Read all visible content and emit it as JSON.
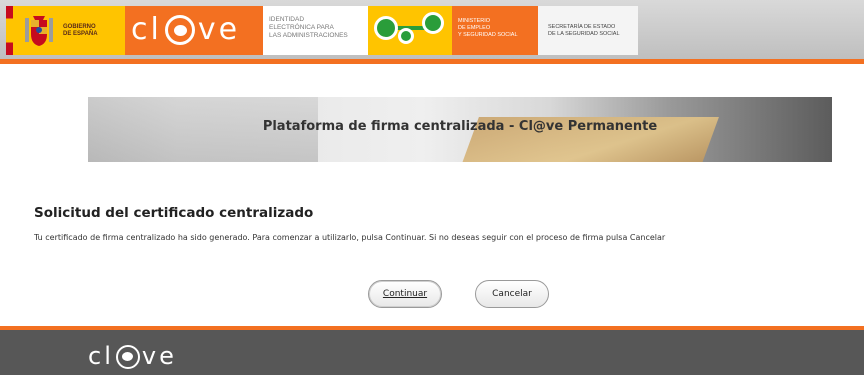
{
  "header": {
    "gov_text_line1": "GOBIERNO",
    "gov_text_line2": "DE ESPAÑA",
    "clave_logo_left": "cl",
    "clave_logo_right": "ve",
    "idade_line1": "IDENTIDAD",
    "idade_line2": "ELECTRÓNICA PARA",
    "idade_line3": "LAS ADMINISTRACIONES",
    "ministry_line1": "MINISTERIO",
    "ministry_line2": "DE EMPLEO",
    "ministry_line3": "Y SEGURIDAD SOCIAL",
    "secretaria_line1": "SECRETARÍA DE ESTADO",
    "secretaria_line2": "DE LA SEGURIDAD SOCIAL",
    "colors": {
      "orange": "#f37021",
      "yellow": "#ffc400",
      "green": "#2a9d3a"
    }
  },
  "banner": {
    "title": "Plataforma de firma centralizada - Cl@ve Permanente"
  },
  "main": {
    "section_title": "Solicitud del certificado centralizado",
    "message": "Tu certificado de firma centralizado ha sido generado. Para comenzar a utilizarlo, pulsa Continuar. Si no deseas seguir con el proceso de firma pulsa Cancelar",
    "continue_label": "Continuar",
    "cancel_label": "Cancelar"
  },
  "footer": {
    "logo_left": "cl",
    "logo_right": "ve",
    "colors": {
      "background": "#575757",
      "accent": "#f37021"
    }
  }
}
